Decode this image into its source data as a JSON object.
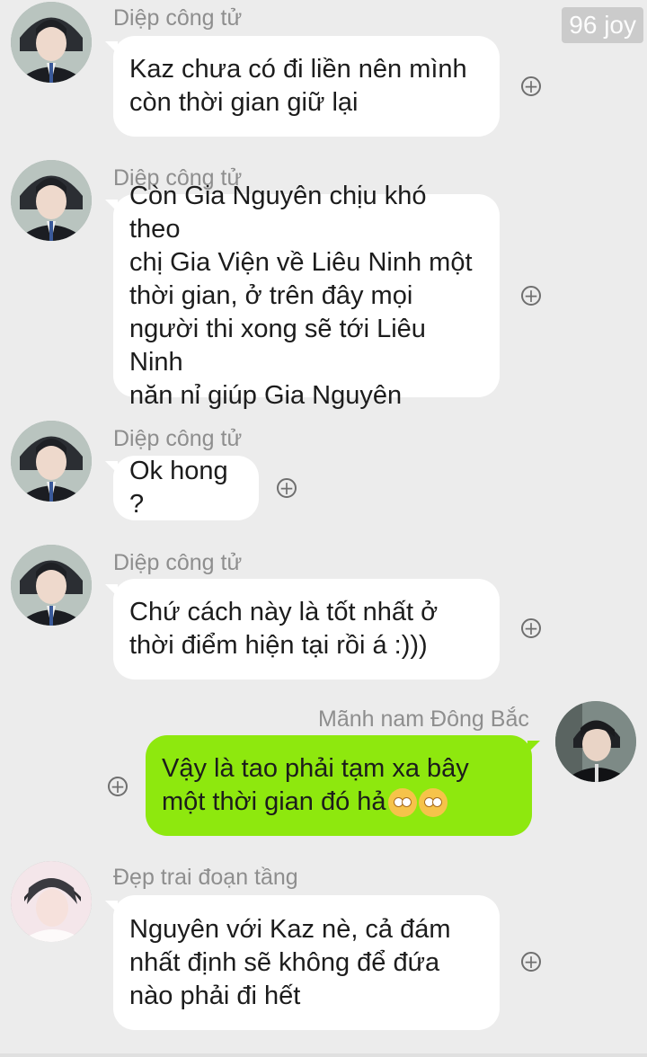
{
  "watermark": "96 joy",
  "messages": [
    {
      "sender": "Diệp công tử",
      "text": "Kaz chưa có đi liền nên mình\ncòn thời gian giữ lại"
    },
    {
      "sender": "Diệp công tử",
      "text": "Còn Gia Nguyên chịu khó theo\nchị Gia Viện về Liêu Ninh một\nthời gian, ở trên đây mọi\nngười thi xong sẽ tới Liêu Ninh\nnăn nỉ giúp Gia Nguyên"
    },
    {
      "sender": "Diệp công tử",
      "text": "Ok hong ?"
    },
    {
      "sender": "Diệp công tử",
      "text": "Chứ cách này là tốt nhất ở\nthời điểm hiện tại rồi á :)))"
    },
    {
      "sender": "Mãnh nam Đông Bắc",
      "text": "Vậy là tao phải tạm xa bây\nmột thời gian đó hả",
      "emoji": "pleading-face-emoji"
    },
    {
      "sender": "Đẹp trai đoạn tầng",
      "text": "Nguyên với Kaz nè, cả đám\nnhất định sẽ không để đứa\nnào phải đi hết"
    }
  ],
  "colors": {
    "background": "#ececec",
    "incoming_bubble": "#ffffff",
    "outgoing_bubble": "#8ee80e",
    "sender_text": "#8e8e8e"
  },
  "icons": {
    "add": "plus-circle-icon",
    "avatar": "avatar-photo"
  }
}
